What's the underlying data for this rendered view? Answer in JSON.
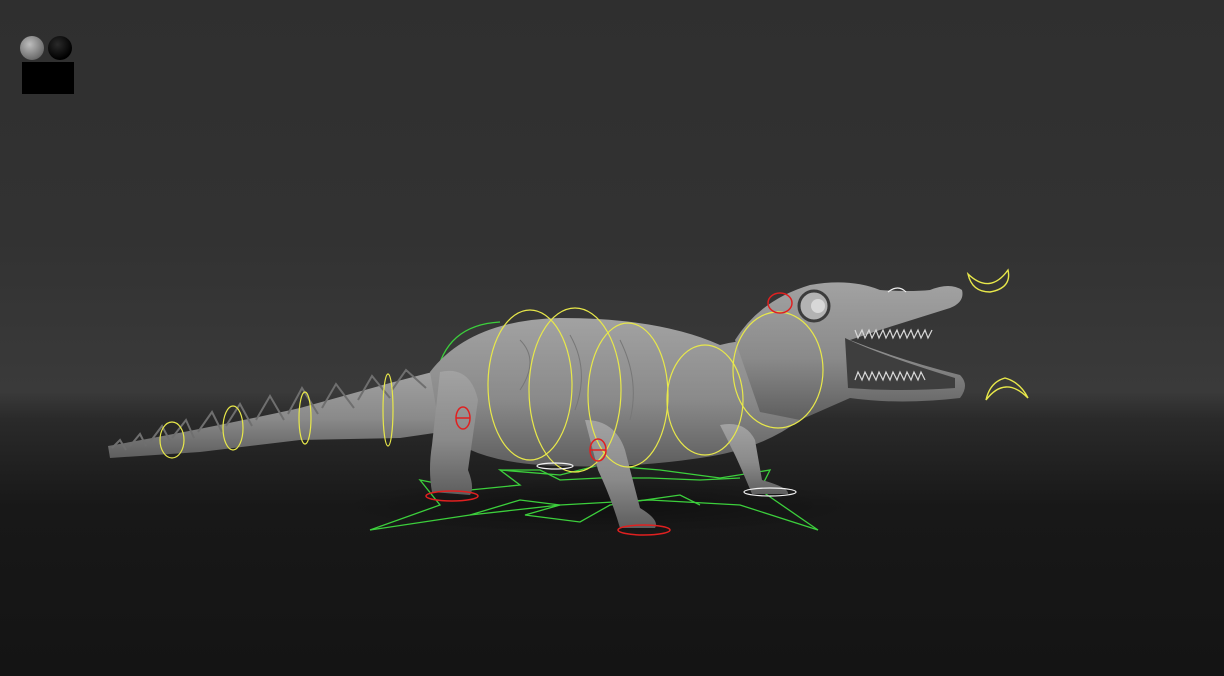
{
  "viewport": {
    "background_top": "#2f2f2f",
    "background_bottom": "#141414"
  },
  "display_mode_icon": "shaded-display-mode-icon",
  "model": {
    "mesh_color": "#8a8a8a",
    "control_colors": {
      "ik_controls": "#e8e84a",
      "fk_controls": "#e02020",
      "root_controls": "#3ccf3c",
      "foot_pivots": "#f0f0f0"
    }
  }
}
